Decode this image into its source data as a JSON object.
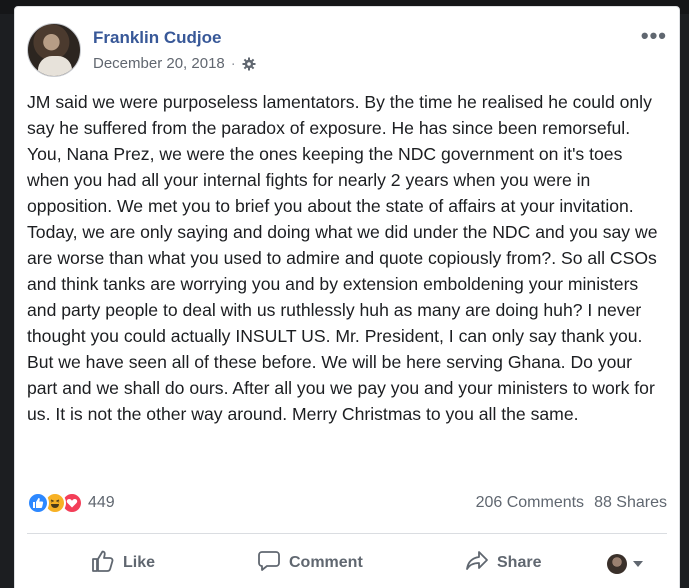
{
  "post": {
    "author": "Franklin Cudjoe",
    "date": "December 20, 2018",
    "separator": "·",
    "text": "JM said we were purposeless lamentators. By the time he realised he could only say he suffered from the paradox of exposure. He has since been remorseful.\nYou, Nana Prez, we were the ones keeping the NDC government on it's toes when you had all your internal fights for nearly 2 years when you were in opposition. We met you to brief you about the state of affairs at your invitation. Today, we are only saying and doing what we did under the NDC and you say we are worse than what you used to admire and quote copiously from?. So all CSOs and think tanks are worrying you and by extension emboldening your ministers and party people to deal with us ruthlessly huh as many are doing huh? I never thought you could actually INSULT US. Mr. President, I can only say thank you. But we have seen all of these before. We will be here serving Ghana. Do your part and we shall do ours. After all you we pay you and your ministers to work for us. It is not the other way around. Merry Christmas to you all the same.",
    "more_icon": "•••"
  },
  "stats": {
    "reaction_count": "449",
    "comments": "206 Comments",
    "shares": "88 Shares"
  },
  "actions": {
    "like": "Like",
    "comment": "Comment",
    "share": "Share"
  },
  "icons": {
    "privacy": "gear-icon",
    "like": "thumbs-up-icon",
    "comment": "speech-bubble-icon",
    "share": "share-arrow-icon"
  },
  "colors": {
    "author_link": "#385898",
    "like_reaction": "#2d88ff",
    "haha_reaction": "#f7b125",
    "love_reaction": "#f33e58",
    "muted_text": "#606770"
  }
}
